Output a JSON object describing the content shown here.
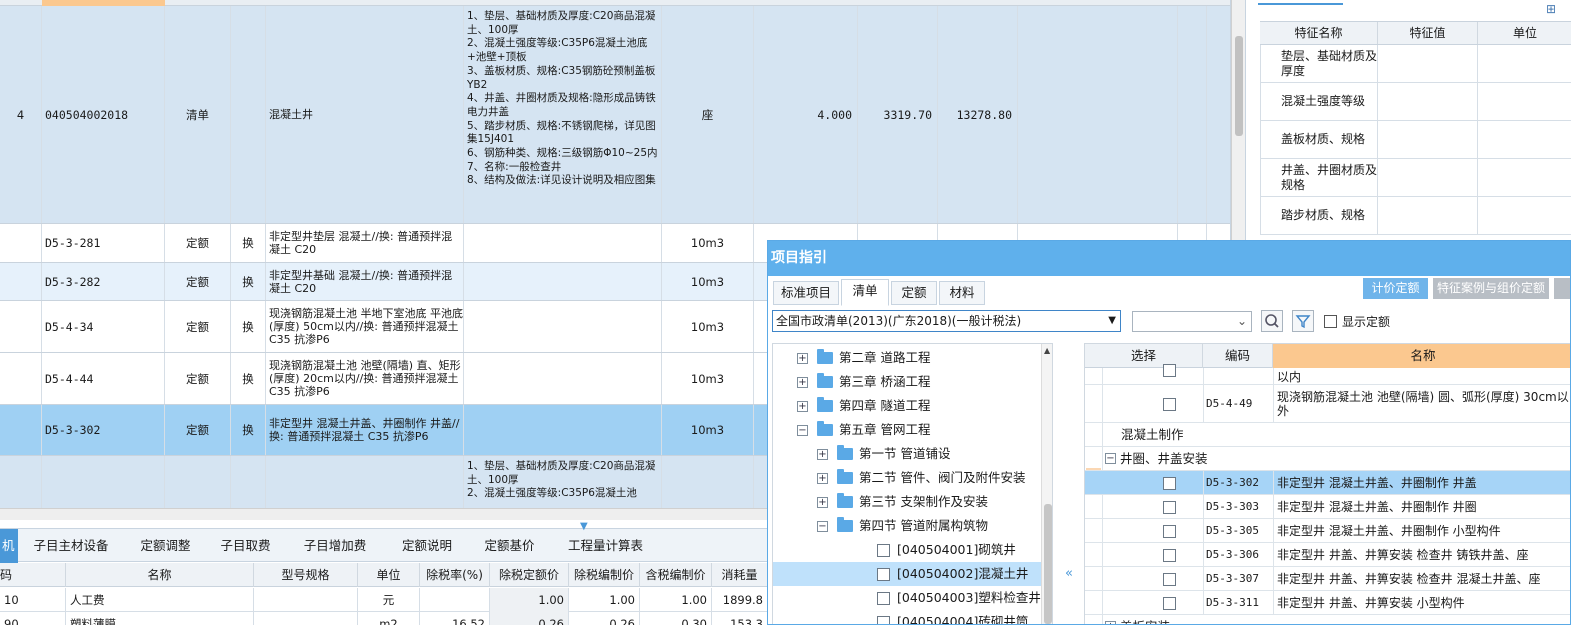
{
  "main_grid": {
    "rows": [
      {
        "kind": "qd",
        "index": "4",
        "code": "040504002018",
        "type": "清单",
        "name": "混凝土井",
        "features": "1、垫层、基础材质及厚度:C20商品混凝土、100厚\n2、混凝土强度等级:C35P6混凝土池底+池壁+顶板\n3、盖板材质、规格:C35钢筋砼预制盖板YB2\n4、井盖、井圈材质及规格:隐形成品铸铁电力井盖\n5、踏步材质、规格:不锈钢爬梯，详见图集15J401\n6、钢筋种类、规格:三级钢筋Φ10~25内\n7、名称:一般检查井\n8、结构及做法:详见设计说明及相应图集",
        "unit": "座",
        "qty": "4.000",
        "price": "3319.70",
        "total": "13278.80"
      },
      {
        "kind": "de",
        "code": "D5-3-281",
        "type": "定额",
        "flag": "换",
        "name": "非定型井垫层 混凝土//换: 普通预拌混凝土 C20",
        "unit": "10m3"
      },
      {
        "kind": "de",
        "code": "D5-3-282",
        "type": "定额",
        "flag": "换",
        "name": "非定型井基础 混凝土//换: 普通预拌混凝土 C20",
        "unit": "10m3"
      },
      {
        "kind": "de",
        "code": "D5-4-34",
        "type": "定额",
        "flag": "换",
        "name": "现浇钢筋混凝土池 半地下室池底 平池底(厚度) 50cm以内//换: 普通预拌混凝土 C35 抗渗P6",
        "unit": "10m3"
      },
      {
        "kind": "de",
        "code": "D5-4-44",
        "type": "定额",
        "flag": "换",
        "name": "现浇钢筋混凝土池 池壁(隔墙) 直、矩形(厚度) 20cm以内//换: 普通预拌混凝土 C35 抗渗P6",
        "unit": "10m3"
      },
      {
        "kind": "de",
        "code": "D5-3-302",
        "type": "定额",
        "flag": "换",
        "name": "非定型井 混凝土井盖、井圈制作 井盖//换: 普通预拌混凝土 C35 抗渗P6",
        "unit": "10m3"
      },
      {
        "kind": "qd2",
        "features": "1、垫层、基础材质及厚度:C20商品混凝土、100厚\n2、混凝土强度等级:C35P6混凝土池"
      }
    ]
  },
  "bottom": {
    "tabs": [
      "机",
      "子目主材设备",
      "定额调整",
      "子目取费",
      "子目增加费",
      "定额说明",
      "定额基价",
      "工程量计算表"
    ],
    "headers": [
      "码",
      "名称",
      "型号规格",
      "单位",
      "除税率(%)",
      "除税定额价",
      "除税编制价",
      "含税编制价",
      "消耗量"
    ],
    "rows": [
      {
        "code": "10",
        "name": "人工费",
        "spec": "",
        "unit": "元",
        "rate": "",
        "base": "1.00",
        "tax_ex": "1.00",
        "tax_in": "1.00",
        "qty": "1899.8"
      },
      {
        "code": "90",
        "name": "塑料薄膜",
        "spec": "",
        "unit": "m2",
        "rate": "16.52",
        "base": "0.26",
        "tax_ex": "0.26",
        "tax_in": "0.30",
        "qty": "153.3"
      }
    ]
  },
  "right_panel": {
    "headers": [
      "特征名称",
      "特征值",
      "单位"
    ],
    "rows": [
      {
        "name": "垫层、基础材质及厚度"
      },
      {
        "name": "混凝土强度等级"
      },
      {
        "name": "盖板材质、规格"
      },
      {
        "name": "井盖、井圈材质及规格"
      },
      {
        "name": "踏步材质、规格"
      }
    ],
    "icon": "tree-icon"
  },
  "dialog": {
    "title": "项目指引",
    "tabs": [
      "标准项目",
      "清单",
      "定额",
      "材料"
    ],
    "active_tab": "清单",
    "buttons": {
      "quota": "计价定额",
      "cases": "特征案例与组价定额"
    },
    "library_select": "全国市政清单(2013)(广东2018)(一般计税法)",
    "search_value": "",
    "show_quota_label": "显示定额",
    "tree": [
      {
        "level": 0,
        "expander": "+",
        "icon": "folder-icon",
        "label": "第二章  道路工程"
      },
      {
        "level": 0,
        "expander": "+",
        "icon": "folder-icon",
        "label": "第三章  桥涵工程"
      },
      {
        "level": 0,
        "expander": "+",
        "icon": "folder-icon",
        "label": "第四章  隧道工程"
      },
      {
        "level": 0,
        "expander": "-",
        "icon": "folder-icon",
        "label": "第五章  管网工程"
      },
      {
        "level": 1,
        "expander": "+",
        "icon": "folder-icon",
        "label": "第一节  管道铺设"
      },
      {
        "level": 1,
        "expander": "+",
        "icon": "folder-icon",
        "label": "第二节  管件、阀门及附件安装"
      },
      {
        "level": 1,
        "expander": "+",
        "icon": "folder-icon",
        "label": "第三节  支架制作及安装"
      },
      {
        "level": 1,
        "expander": "-",
        "icon": "folder-icon",
        "label": "第四节  管道附属构筑物"
      },
      {
        "level": 2,
        "check": true,
        "label": "[040504001]砌筑井"
      },
      {
        "level": 2,
        "check": true,
        "label": "[040504002]混凝土井",
        "selected": true
      },
      {
        "level": 2,
        "check": true,
        "label": "[040504003]塑料检查井"
      },
      {
        "level": 2,
        "check": true,
        "label": "[040504004]砖砌井筒"
      }
    ],
    "quota_headers": [
      "选择",
      "编码",
      "名称"
    ],
    "quota_rows": [
      {
        "kind": "row",
        "code": "",
        "name": "以内",
        "partial": true
      },
      {
        "kind": "row",
        "code": "D5-4-49",
        "name": "现浇钢筋混凝土池 池壁(隔墙) 圆、弧形(厚度) 30cm以外",
        "tall": true
      },
      {
        "kind": "group",
        "expander": "",
        "label": "混凝土制作"
      },
      {
        "kind": "group",
        "expander": "-",
        "label": "井圈、井盖安装"
      },
      {
        "kind": "row",
        "code": "D5-3-302",
        "name": "非定型井 混凝土井盖、井圈制作 井盖",
        "selected": true
      },
      {
        "kind": "row",
        "code": "D5-3-303",
        "name": "非定型井 混凝土井盖、井圈制作 井圈"
      },
      {
        "kind": "row",
        "code": "D5-3-305",
        "name": "非定型井 混凝土井盖、井圈制作 小型构件"
      },
      {
        "kind": "row",
        "code": "D5-3-306",
        "name": "非定型井 井盖、井箅安装 检查井 铸铁井盖、座"
      },
      {
        "kind": "row",
        "code": "D5-3-307",
        "name": "非定型井 井盖、井箅安装 检查井 混凝土井盖、座"
      },
      {
        "kind": "row",
        "code": "D5-3-311",
        "name": "非定型井 井盖、井箅安装 小型构件"
      },
      {
        "kind": "group",
        "expander": "+",
        "label": "盖板安装"
      }
    ]
  },
  "colors": {
    "accent": "#4a98d8",
    "selected_row": "#a6d4f7",
    "qd_row": "#d3e3f2",
    "title_bar": "#5fb0ec"
  }
}
